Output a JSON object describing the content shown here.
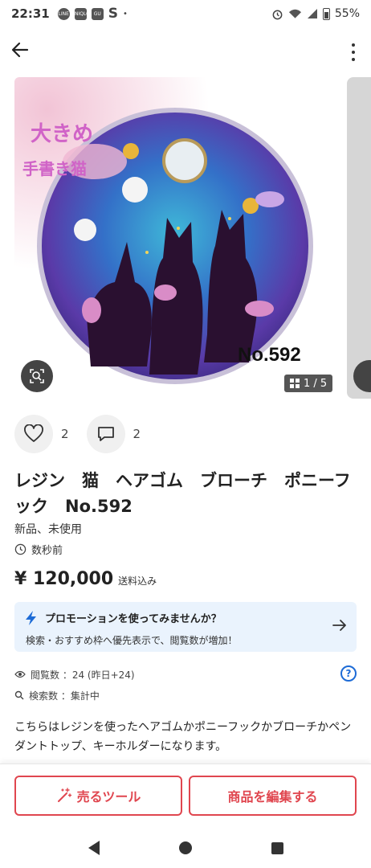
{
  "status_bar": {
    "time": "22:31",
    "app_icons": [
      "LINE",
      "UNIQLO",
      "GU"
    ],
    "s_icon": "S",
    "dot": "•",
    "battery_percent": "55%"
  },
  "product": {
    "image_overlay": {
      "line1": "大きめ",
      "line2": "手書き猫",
      "number": "No.592"
    },
    "image_counter": "1 / 5",
    "likes": "2",
    "comments": "2",
    "title": "レジン　猫　ヘアゴム　ブローチ　ポニーフック　No.592",
    "condition": "新品、未使用",
    "posted": "数秒前",
    "price": "¥ 120,000",
    "shipping": "送料込み"
  },
  "promo": {
    "title": "プロモーションを使ってみませんか？",
    "subtitle": "検索・おすすめ枠へ優先表示で、閲覧数が増加！"
  },
  "stats": {
    "views": "閲覧数 ：24 (昨日+24)",
    "searches": "検索数 ：集計中"
  },
  "description": "こちらはレジンを使ったヘアゴムかポニーフックかブローチかペンダントトップ、キーホルダーになります。",
  "buttons": {
    "sell_tools": "売るツール",
    "edit_item": "商品を編集する"
  },
  "colors": {
    "accent_red": "#e0464f",
    "promo_bg": "#eaf3fd",
    "link_blue": "#1d6bd6"
  }
}
